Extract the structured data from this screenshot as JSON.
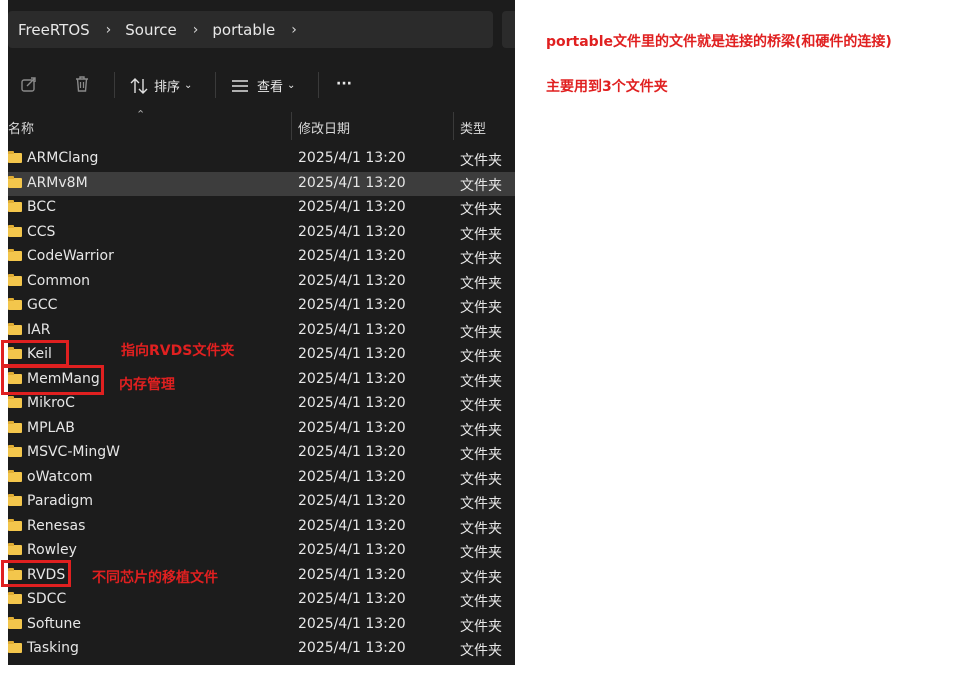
{
  "breadcrumb": [
    "FreeRTOS",
    "Source",
    "portable"
  ],
  "breadcrumb_sep": "›",
  "toolbar": {
    "sort_label": "排序",
    "view_label": "查看",
    "more_label": "···"
  },
  "columns": {
    "name": "名称",
    "date": "修改日期",
    "type": "类型"
  },
  "rows": [
    {
      "name": "ARMClang",
      "date": "2025/4/1 13:20",
      "type": "文件夹"
    },
    {
      "name": "ARMv8M",
      "date": "2025/4/1 13:20",
      "type": "文件夹",
      "selected": true
    },
    {
      "name": "BCC",
      "date": "2025/4/1 13:20",
      "type": "文件夹"
    },
    {
      "name": "CCS",
      "date": "2025/4/1 13:20",
      "type": "文件夹"
    },
    {
      "name": "CodeWarrior",
      "date": "2025/4/1 13:20",
      "type": "文件夹"
    },
    {
      "name": "Common",
      "date": "2025/4/1 13:20",
      "type": "文件夹"
    },
    {
      "name": "GCC",
      "date": "2025/4/1 13:20",
      "type": "文件夹"
    },
    {
      "name": "IAR",
      "date": "2025/4/1 13:20",
      "type": "文件夹"
    },
    {
      "name": "Keil",
      "date": "2025/4/1 13:20",
      "type": "文件夹"
    },
    {
      "name": "MemMang",
      "date": "2025/4/1 13:20",
      "type": "文件夹"
    },
    {
      "name": "MikroC",
      "date": "2025/4/1 13:20",
      "type": "文件夹"
    },
    {
      "name": "MPLAB",
      "date": "2025/4/1 13:20",
      "type": "文件夹"
    },
    {
      "name": "MSVC-MingW",
      "date": "2025/4/1 13:20",
      "type": "文件夹"
    },
    {
      "name": "oWatcom",
      "date": "2025/4/1 13:20",
      "type": "文件夹"
    },
    {
      "name": "Paradigm",
      "date": "2025/4/1 13:20",
      "type": "文件夹"
    },
    {
      "name": "Renesas",
      "date": "2025/4/1 13:20",
      "type": "文件夹"
    },
    {
      "name": "Rowley",
      "date": "2025/4/1 13:20",
      "type": "文件夹"
    },
    {
      "name": "RVDS",
      "date": "2025/4/1 13:20",
      "type": "文件夹"
    },
    {
      "name": "SDCC",
      "date": "2025/4/1 13:20",
      "type": "文件夹"
    },
    {
      "name": "Softune",
      "date": "2025/4/1 13:20",
      "type": "文件夹"
    },
    {
      "name": "Tasking",
      "date": "2025/4/1 13:20",
      "type": "文件夹"
    }
  ],
  "annotations": {
    "note_title": "portable文件里的文件就是连接的桥梁(和硬件的连接)",
    "note_folders": "主要用到3个文件夹",
    "keil_note": "指向RVDS文件夹",
    "memmang_note": "内存管理",
    "rvds_note": "不同芯片的移植文件"
  },
  "colors": {
    "annotation_red": "#e02020",
    "window_bg": "#1c1c1c",
    "folder_yellow": "#f3c64c"
  }
}
